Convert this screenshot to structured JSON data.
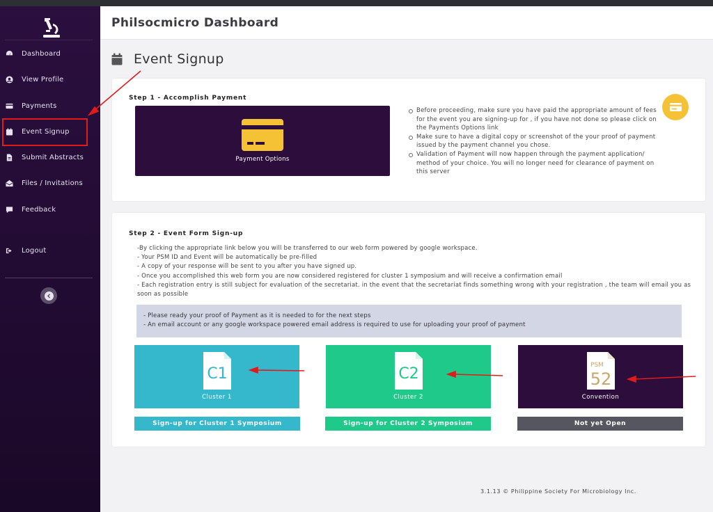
{
  "app": {
    "title": "Philsocmicro Dashboard"
  },
  "sidebar": {
    "logo_icon": "microscope-logo-icon",
    "items": [
      {
        "label": "Dashboard",
        "icon": "dashboard-gauge-icon"
      },
      {
        "label": "View Profile",
        "icon": "user-circle-icon"
      },
      {
        "label": "Payments",
        "icon": "credit-card-icon"
      },
      {
        "label": "Event Signup",
        "icon": "calendar-icon",
        "active": true
      },
      {
        "label": "Submit Abstracts",
        "icon": "file-icon"
      },
      {
        "label": "Files / Invitations",
        "icon": "envelope-open-icon"
      },
      {
        "label": "Feedback",
        "icon": "comment-icon"
      },
      {
        "label": "Logout",
        "icon": "sign-out-icon"
      }
    ],
    "collapse_icon": "chevron-left-circle-icon"
  },
  "page": {
    "title": "Event Signup",
    "icon": "calendar-icon"
  },
  "step1": {
    "title": "Step 1 - Accomplish Payment",
    "payment_options_label": "Payment Options",
    "notes": [
      "Before proceeding, make sure you have paid the appropriate amount of fees for the event you are signing-up for , if you have not done so please click on the Payments Options link",
      "Make sure to have a digital copy or screenshot of the your proof of payment issued by the payment channel you chose.",
      "Validation of Payment will now happen through the payment application/ method of your choice. You will no longer need for clearance of payment on this server"
    ],
    "badge_icon": "money-card-icon"
  },
  "step2": {
    "title": "Step 2 - Event Form Sign-up",
    "description": [
      "-By clicking the appropriate link below you will be transferred to our web form powered by google workspace.",
      "- Your PSM ID and Event will be automatically be pre-filled",
      "- A copy of your response will be sent to you after you have signed up.",
      "- Once you accomplished this web form you are now considered registered for cluster 1 symposium and will receive a confirmation email",
      "- Each registration entry is still subject for evaluation of the secretariat. in the event that the secretariat finds something wrong with your registration , the team will email you as soon as possible"
    ],
    "notice": [
      "- Please ready your proof of Payment as it is needed to for the next steps",
      "- An email account or any google workspace powered email address is required to use for uploading your proof of payment"
    ],
    "tiles": [
      {
        "icon_text": "C1",
        "caption": "Cluster 1",
        "button": "Sign-up for Cluster 1 Symposium",
        "color": "#35b8cc"
      },
      {
        "icon_text": "C2",
        "caption": "Cluster 2",
        "button": "Sign-up for Cluster 2 Symposium",
        "color": "#1ec98a"
      },
      {
        "icon_text_top": "PSM",
        "icon_text": "52",
        "caption": "Convention",
        "button": "Not yet Open",
        "color": "#2d0d3b"
      }
    ]
  },
  "footer": {
    "text": "3.1.13 © Philippine Society For Microbiology Inc."
  },
  "colors": {
    "sidebar": "#2b0f3f",
    "accent_yellow": "#f5c236",
    "annotation_red": "#e01b1b"
  }
}
